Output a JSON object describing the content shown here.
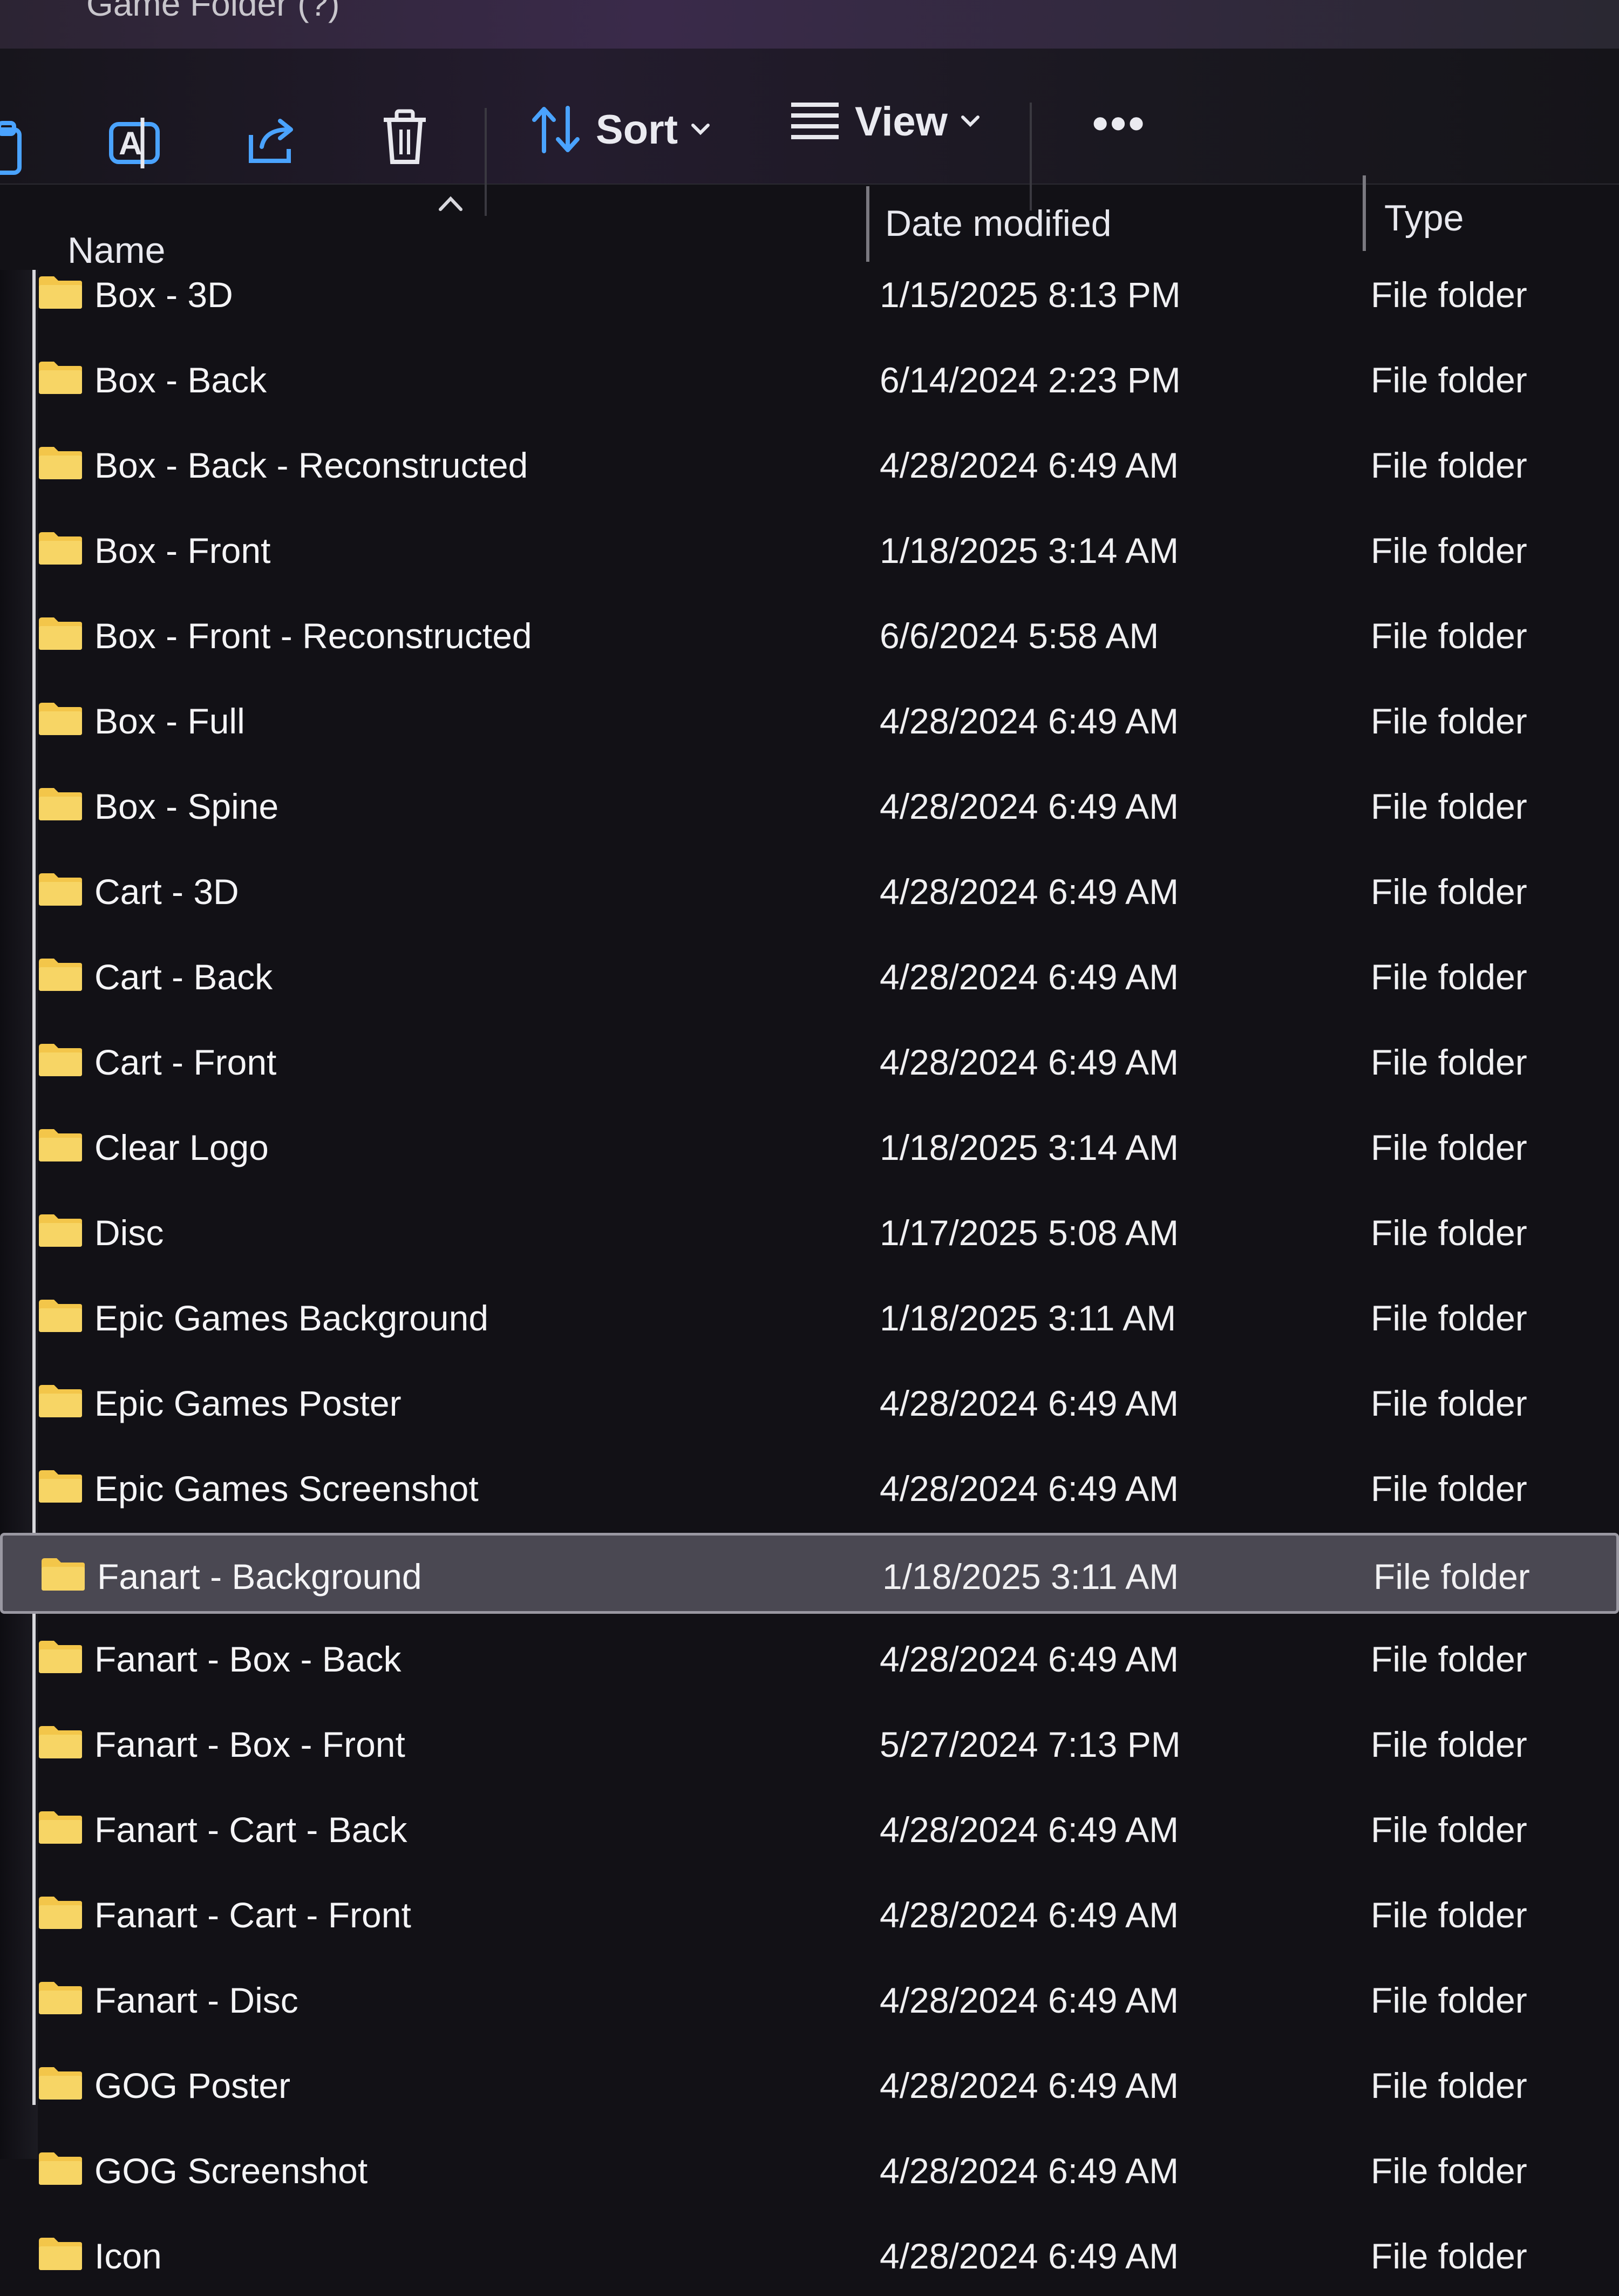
{
  "window": {
    "breadcrumb": "Game Folder (?)"
  },
  "toolbar": {
    "sort_label": "Sort",
    "view_label": "View",
    "more_label": "•••"
  },
  "columns": {
    "name": "Name",
    "date_modified": "Date modified",
    "type": "Type"
  },
  "files": [
    {
      "name": "Box - 3D",
      "date": "1/15/2025 8:13 PM",
      "type": "File folder"
    },
    {
      "name": "Box - Back",
      "date": "6/14/2024 2:23 PM",
      "type": "File folder"
    },
    {
      "name": "Box - Back - Reconstructed",
      "date": "4/28/2024 6:49 AM",
      "type": "File folder"
    },
    {
      "name": "Box - Front",
      "date": "1/18/2025 3:14 AM",
      "type": "File folder"
    },
    {
      "name": "Box - Front - Reconstructed",
      "date": "6/6/2024 5:58 AM",
      "type": "File folder"
    },
    {
      "name": "Box - Full",
      "date": "4/28/2024 6:49 AM",
      "type": "File folder"
    },
    {
      "name": "Box - Spine",
      "date": "4/28/2024 6:49 AM",
      "type": "File folder"
    },
    {
      "name": "Cart - 3D",
      "date": "4/28/2024 6:49 AM",
      "type": "File folder"
    },
    {
      "name": "Cart - Back",
      "date": "4/28/2024 6:49 AM",
      "type": "File folder"
    },
    {
      "name": "Cart - Front",
      "date": "4/28/2024 6:49 AM",
      "type": "File folder"
    },
    {
      "name": "Clear Logo",
      "date": "1/18/2025 3:14 AM",
      "type": "File folder"
    },
    {
      "name": "Disc",
      "date": "1/17/2025 5:08 AM",
      "type": "File folder"
    },
    {
      "name": "Epic Games Background",
      "date": "1/18/2025 3:11 AM",
      "type": "File folder"
    },
    {
      "name": "Epic Games Poster",
      "date": "4/28/2024 6:49 AM",
      "type": "File folder"
    },
    {
      "name": "Epic Games Screenshot",
      "date": "4/28/2024 6:49 AM",
      "type": "File folder"
    },
    {
      "name": "Fanart - Background",
      "date": "1/18/2025 3:11 AM",
      "type": "File folder",
      "selected": true
    },
    {
      "name": "Fanart - Box - Back",
      "date": "4/28/2024 6:49 AM",
      "type": "File folder"
    },
    {
      "name": "Fanart - Box - Front",
      "date": "5/27/2024 7:13 PM",
      "type": "File folder"
    },
    {
      "name": "Fanart - Cart - Back",
      "date": "4/28/2024 6:49 AM",
      "type": "File folder"
    },
    {
      "name": "Fanart - Cart - Front",
      "date": "4/28/2024 6:49 AM",
      "type": "File folder"
    },
    {
      "name": "Fanart - Disc",
      "date": "4/28/2024 6:49 AM",
      "type": "File folder"
    },
    {
      "name": "GOG Poster",
      "date": "4/28/2024 6:49 AM",
      "type": "File folder"
    },
    {
      "name": "GOG Screenshot",
      "date": "4/28/2024 6:49 AM",
      "type": "File folder"
    },
    {
      "name": "Icon",
      "date": "4/28/2024 6:49 AM",
      "type": "File folder"
    }
  ],
  "colors": {
    "folder": "#f3c64a",
    "selected_row": "#4a4852",
    "accent_icon": "#4aa3ff"
  }
}
